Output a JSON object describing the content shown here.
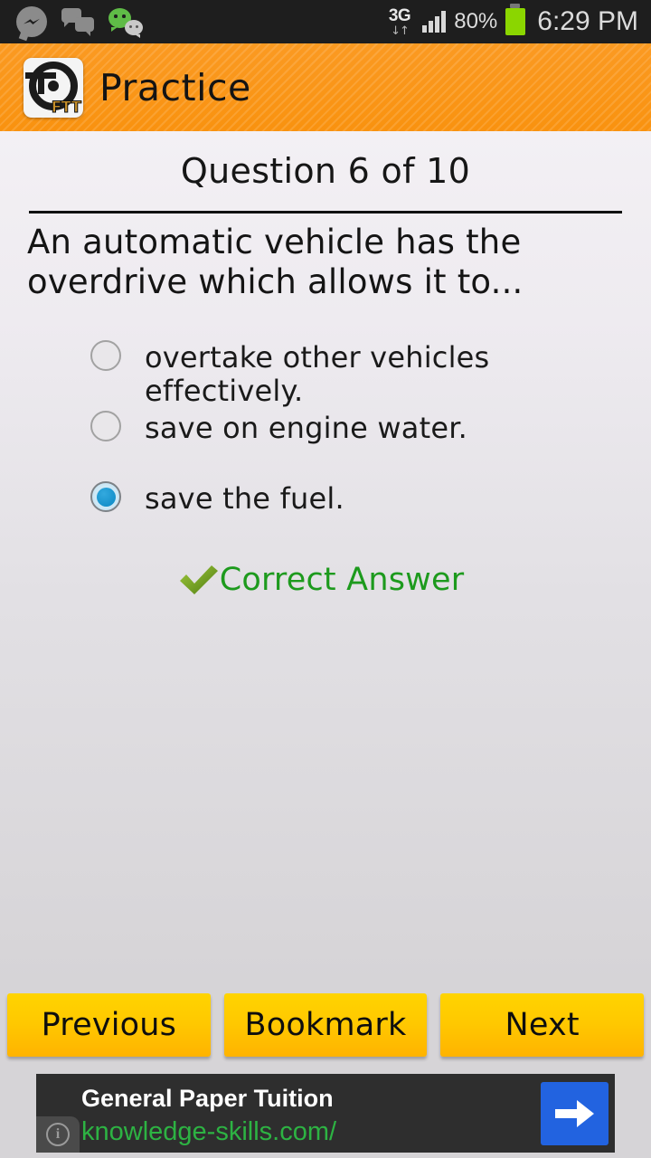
{
  "statusbar": {
    "icons": [
      "messenger-icon",
      "chat-bubbles-icon",
      "wechat-icon"
    ],
    "network_type": "3G",
    "data_arrows": "↓↑",
    "signal": "signal-bars-icon",
    "battery_percent": "80%",
    "battery": "battery-icon",
    "time": "6:29 PM"
  },
  "appbar": {
    "logo": "steering-wheel-ftt-logo",
    "logo_text": "FTT",
    "title": "Practice"
  },
  "quiz": {
    "counter": "Question 6 of 10",
    "question": "An automatic vehicle has the overdrive which allows it to...",
    "options": [
      {
        "label": "overtake other vehicles effectively.",
        "selected": false
      },
      {
        "label": "save on engine water.",
        "selected": false
      },
      {
        "label": "save the fuel.",
        "selected": true
      }
    ],
    "feedback": {
      "icon": "check-mark-icon",
      "text": "Correct Answer",
      "color": "#1d9a1d"
    }
  },
  "navigation": {
    "previous_label": "Previous",
    "bookmark_label": "Bookmark",
    "next_label": "Next"
  },
  "ad": {
    "headline": "General Paper Tuition",
    "url": "knowledge-skills.com/",
    "info_icon": "info-icon",
    "info_glyph": "i",
    "cta_icon": "arrow-right-icon"
  },
  "colors": {
    "accent_orange": "#f9920f",
    "button_yellow": "#ffc800",
    "correct_green": "#1d9a1d",
    "radio_blue": "#0a88c4",
    "ad_blue": "#2263e0",
    "ad_green": "#2db343"
  }
}
